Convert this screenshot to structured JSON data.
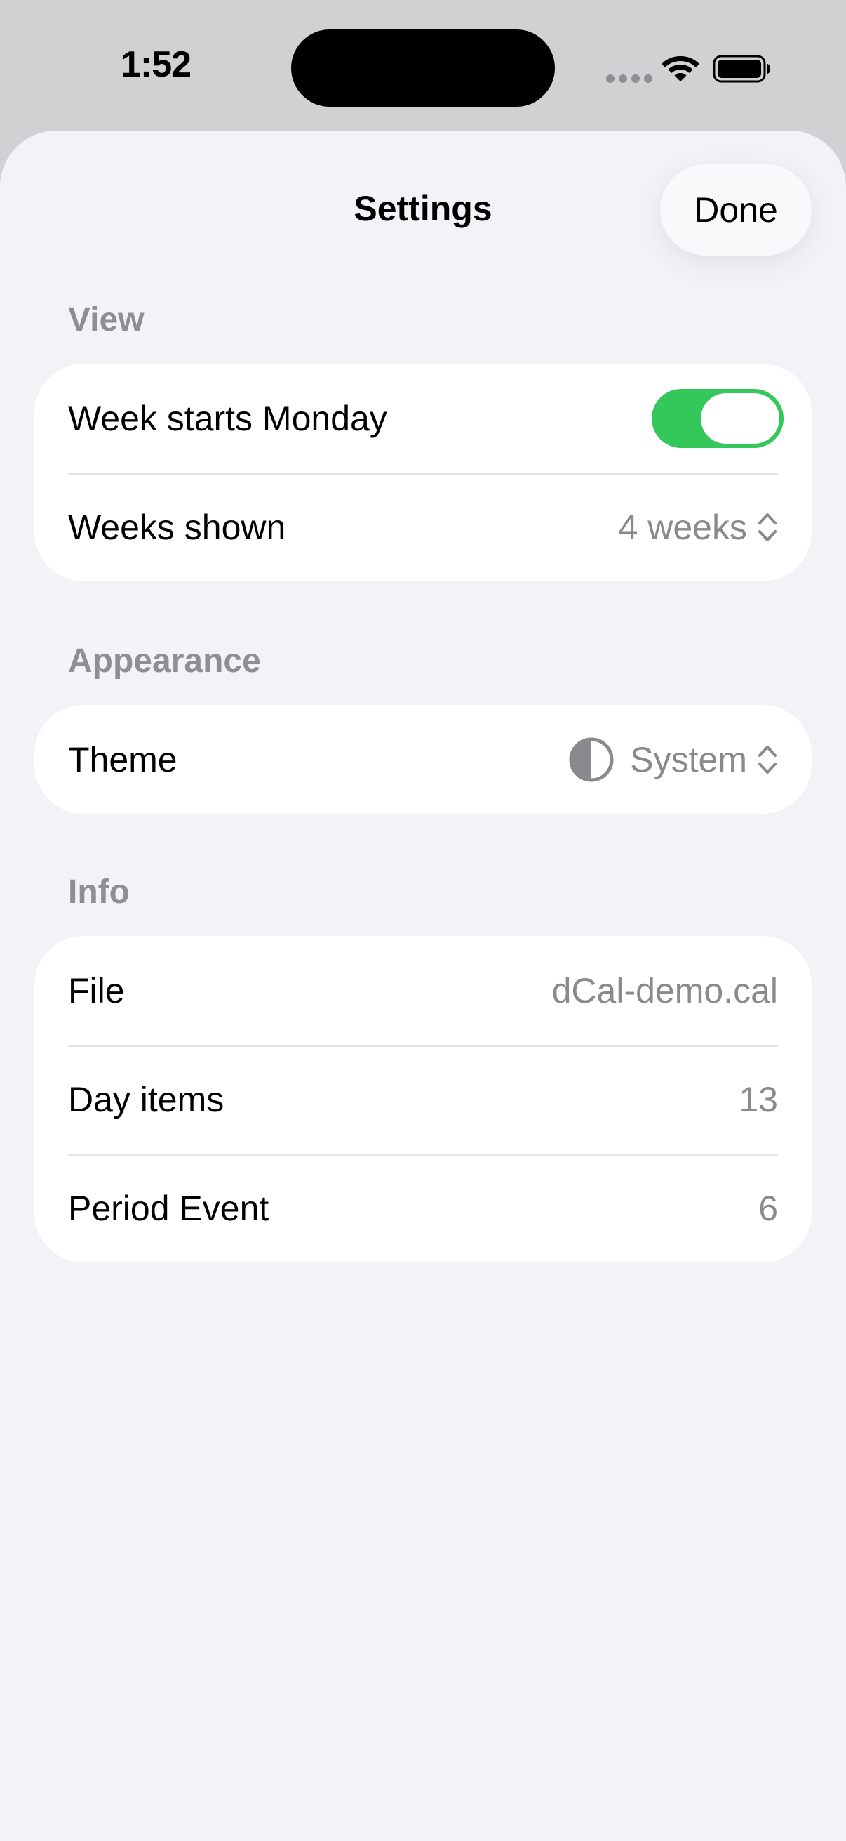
{
  "status_bar": {
    "time": "1:52",
    "wifi_icon": "wifi-icon",
    "battery_icon": "battery-icon"
  },
  "sheet": {
    "title": "Settings",
    "done_label": "Done"
  },
  "sections": {
    "view": {
      "header": "View",
      "week_starts_monday_label": "Week starts Monday",
      "week_starts_monday_on": true,
      "weeks_shown_label": "Weeks shown",
      "weeks_shown_value": "4 weeks"
    },
    "appearance": {
      "header": "Appearance",
      "theme_label": "Theme",
      "theme_value": "System",
      "theme_icon": "half-circle-icon"
    },
    "info": {
      "header": "Info",
      "file_label": "File",
      "file_value": "dCal-demo.cal",
      "day_items_label": "Day items",
      "day_items_value": "13",
      "period_event_label": "Period Event",
      "period_event_value": "6"
    }
  },
  "colors": {
    "toggle_on": "#34c759",
    "secondary_text": "#8a8a8e",
    "background": "#f2f2f7"
  }
}
